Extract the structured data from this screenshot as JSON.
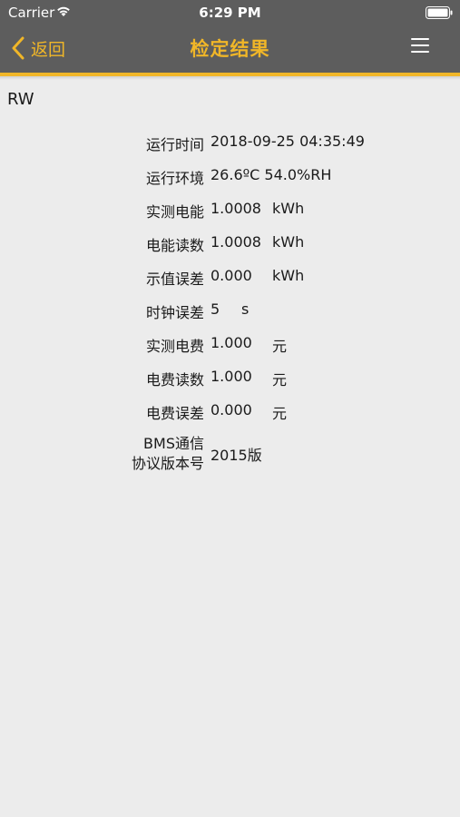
{
  "status_bar": {
    "carrier": "Carrier",
    "time": "6:29 PM"
  },
  "nav": {
    "back_label": "返回",
    "title": "检定结果"
  },
  "device": {
    "label": "RW"
  },
  "results": [
    {
      "label": "运行时间",
      "value": "2018-09-25 04:35:49",
      "unit": ""
    },
    {
      "label": "运行环境",
      "value": "26.6ºC 54.0%RH",
      "unit": ""
    },
    {
      "label": "实测电能",
      "value": "1.0008",
      "unit": "kWh"
    },
    {
      "label": "电能读数",
      "value": "1.0008",
      "unit": "kWh"
    },
    {
      "label": "示值误差",
      "value": "0.000",
      "unit": "kWh"
    },
    {
      "label": "时钟误差",
      "value": "5",
      "unit": "s"
    },
    {
      "label": "实测电费",
      "value": "1.000",
      "unit": "元"
    },
    {
      "label": "电费读数",
      "value": "1.000",
      "unit": "元"
    },
    {
      "label": "电费误差",
      "value": "0.000",
      "unit": "元"
    }
  ],
  "protocol": {
    "label_line1": "BMS通信",
    "label_line2": "协议版本号",
    "value": "2015版"
  },
  "colors": {
    "nav_background": "#5d5d5d",
    "accent": "#f0b628",
    "page_background": "#ececec"
  }
}
